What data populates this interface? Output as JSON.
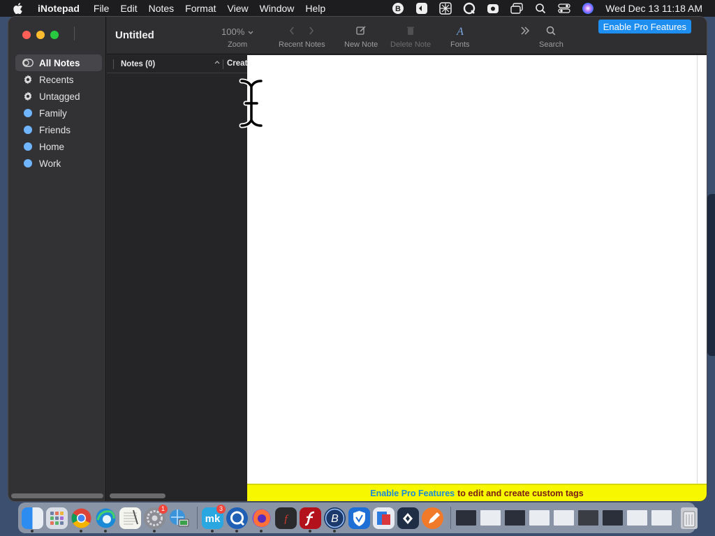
{
  "menubar": {
    "app_name": "iNotepad",
    "items": [
      "File",
      "Edit",
      "Notes",
      "Format",
      "View",
      "Window",
      "Help"
    ],
    "clock": "Wed Dec 13  11:18 AM",
    "status_icons": [
      "bitdefender-icon",
      "tripmode-icon",
      "nordlayer-icon",
      "quicktime-recording-icon",
      "screen-recording-icon",
      "window-manager-icon",
      "spotlight-icon",
      "control-center-icon",
      "siri-icon"
    ]
  },
  "window": {
    "title": "Untitled",
    "toolbar": {
      "zoom_value": "100%",
      "zoom_label": "Zoom",
      "recent_label": "Recent Notes",
      "new_note_label": "New Note",
      "delete_note_label": "Delete Note",
      "fonts_label": "Fonts",
      "search_label": "Search",
      "pro_button": "Enable Pro Features"
    },
    "sidebar": {
      "items": [
        {
          "label": "All Notes",
          "icon": "all-notes-icon",
          "selected": true
        },
        {
          "label": "Recents",
          "icon": "gear-icon"
        },
        {
          "label": "Untagged",
          "icon": "gear-icon"
        },
        {
          "label": "Family",
          "icon": "tag-dot-icon"
        },
        {
          "label": "Friends",
          "icon": "tag-dot-icon"
        },
        {
          "label": "Home",
          "icon": "tag-dot-icon"
        },
        {
          "label": "Work",
          "icon": "tag-dot-icon"
        }
      ]
    },
    "notes_list": {
      "header_notes": "Notes (0)",
      "header_created": "Creat"
    },
    "pro_bar": {
      "link": "Enable Pro Features",
      "rest": "to edit and create custom tags"
    }
  },
  "dock": {
    "apps": [
      "finder",
      "launchpad",
      "chrome",
      "edge",
      "textedit",
      "system-settings",
      "network-radar",
      "mindnode",
      "quicktime",
      "firefox",
      "flash-player",
      "adobe-flash",
      "bitdefender",
      "vpn-shield",
      "remote-desktop",
      "xcode-tools",
      "pencil"
    ],
    "badges": {
      "system-settings": "1",
      "mindnode": "3"
    }
  },
  "colors": {
    "accent": "#1f8ef1",
    "tag_dot": "#6fb6ff",
    "pro_bar_bg": "#f7f700",
    "pro_link": "#1c8bd6",
    "pro_rest": "#7a1d12"
  }
}
